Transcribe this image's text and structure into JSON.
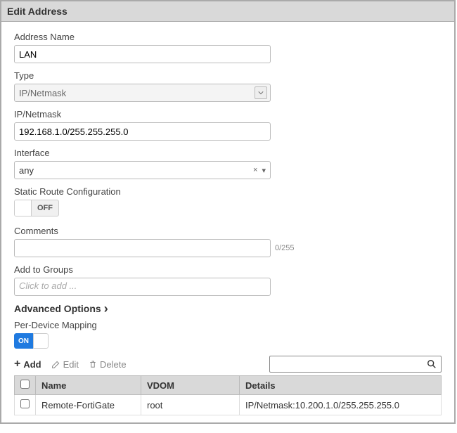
{
  "dialog": {
    "title": "Edit Address"
  },
  "fields": {
    "addressName": {
      "label": "Address Name",
      "value": "LAN"
    },
    "type": {
      "label": "Type",
      "value": "IP/Netmask"
    },
    "ipNetmask": {
      "label": "IP/Netmask",
      "value": "192.168.1.0/255.255.255.0"
    },
    "interface": {
      "label": "Interface",
      "value": "any",
      "clear": "×",
      "caret": "▾"
    },
    "staticRoute": {
      "label": "Static Route Configuration",
      "state": "OFF"
    },
    "comments": {
      "label": "Comments",
      "value": "",
      "counter": "0/255"
    },
    "groups": {
      "label": "Add to Groups",
      "placeholder": "Click to add ..."
    }
  },
  "advanced": {
    "title": "Advanced Options",
    "chevron": "›"
  },
  "perDevice": {
    "label": "Per-Device Mapping",
    "state": "ON"
  },
  "toolbar": {
    "add": {
      "icon": "+",
      "label": "Add"
    },
    "edit": {
      "label": "Edit"
    },
    "del": {
      "label": "Delete"
    }
  },
  "table": {
    "headers": {
      "name": "Name",
      "vdom": "VDOM",
      "details": "Details"
    },
    "rows": [
      {
        "name": "Remote-FortiGate",
        "vdom": "root",
        "details": "IP/Netmask:10.200.1.0/255.255.255.0"
      }
    ]
  }
}
